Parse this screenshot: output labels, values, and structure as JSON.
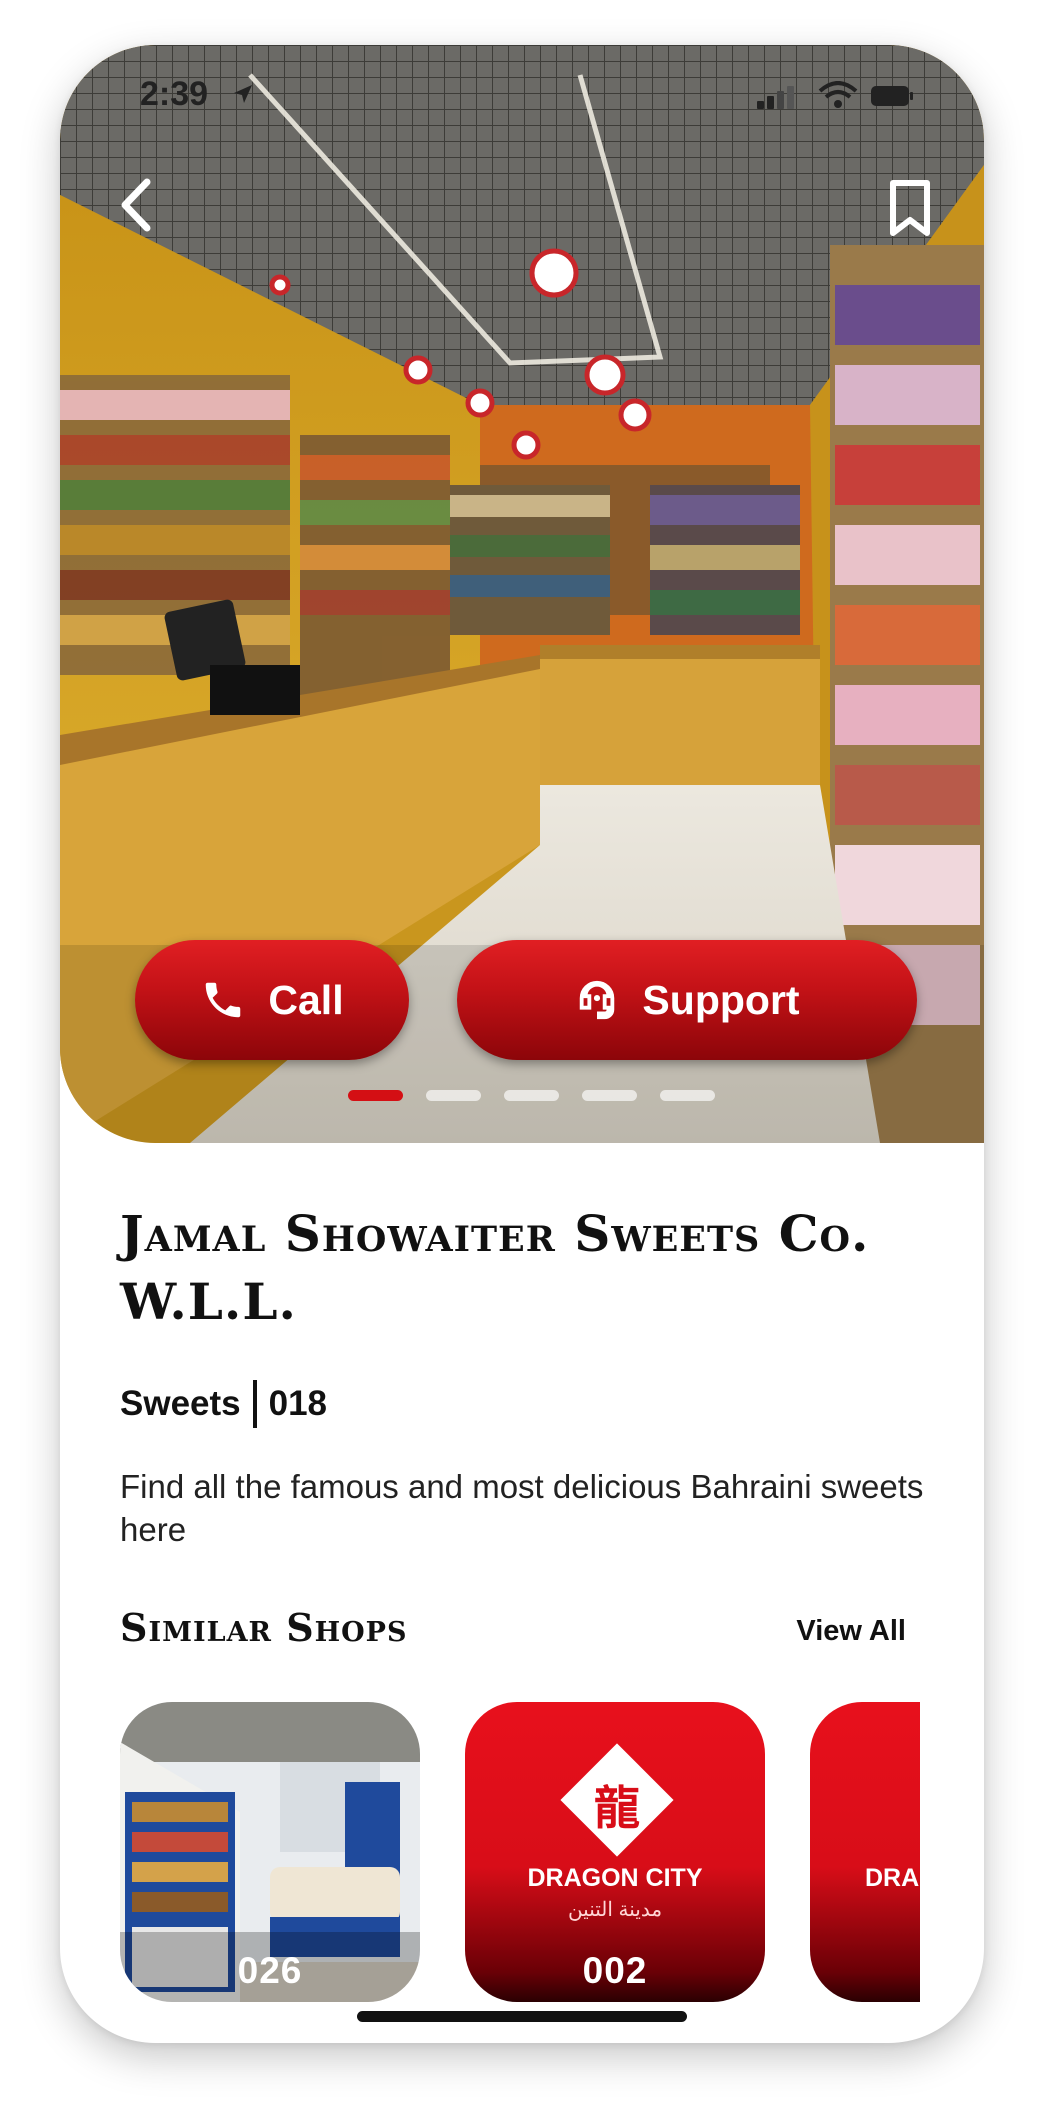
{
  "status_bar": {
    "time": "2:39"
  },
  "hero": {
    "call_label": "Call",
    "support_label": "Support",
    "slides": 5,
    "active_slide": 1
  },
  "shop": {
    "name": "Jamal Showaiter Sweets Co. W.L.L.",
    "category": "Sweets",
    "code": "018",
    "description": "Find all the famous and most delicious Bahraini sweets here"
  },
  "similar": {
    "title": "Similar Shops",
    "view_all": "View All",
    "items": [
      {
        "number": "026"
      },
      {
        "number": "002",
        "brand": "DRAGON CITY",
        "brand_ar": "مدينة التنين",
        "glyph": "龍"
      },
      {
        "brand": "DRA"
      }
    ]
  },
  "colors": {
    "accent": "#d40f14",
    "dark_red": "#8c0509"
  }
}
